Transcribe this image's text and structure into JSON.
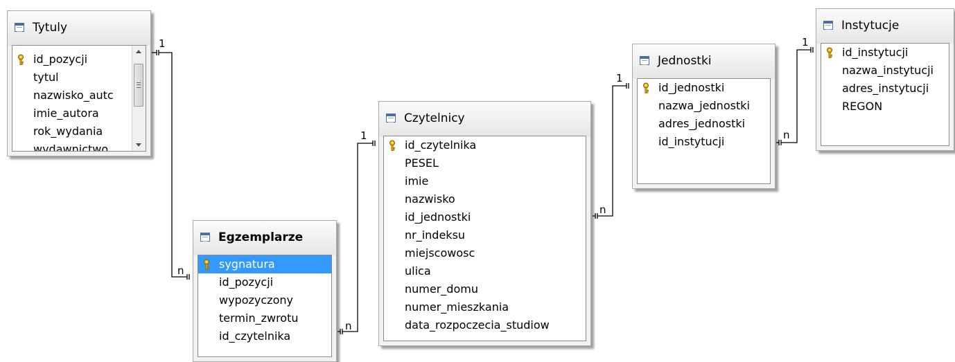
{
  "tables": [
    {
      "id": "tytuly",
      "title": "Tytuly",
      "columns": [
        {
          "name": "id_pozycji",
          "pk": true
        },
        {
          "name": "tytul"
        },
        {
          "name": "nazwisko_autc"
        },
        {
          "name": "imie_autora"
        },
        {
          "name": "rok_wydania"
        },
        {
          "name": "wydawnictwo"
        }
      ]
    },
    {
      "id": "egzemplarze",
      "title": "Egzemplarze",
      "columns": [
        {
          "name": "sygnatura",
          "pk": true
        },
        {
          "name": "id_pozycji"
        },
        {
          "name": "wypozyczony"
        },
        {
          "name": "termin_zwrotu"
        },
        {
          "name": "id_czytelnika"
        }
      ]
    },
    {
      "id": "czytelnicy",
      "title": "Czytelnicy",
      "columns": [
        {
          "name": "id_czytelnika",
          "pk": true
        },
        {
          "name": "PESEL"
        },
        {
          "name": "imie"
        },
        {
          "name": "nazwisko"
        },
        {
          "name": "id_jednostki"
        },
        {
          "name": "nr_indeksu"
        },
        {
          "name": "miejscowosc"
        },
        {
          "name": "ulica"
        },
        {
          "name": "numer_domu"
        },
        {
          "name": "numer_mieszkania"
        },
        {
          "name": "data_rozpoczecia_studiow"
        }
      ]
    },
    {
      "id": "jednostki",
      "title": "Jednostki",
      "columns": [
        {
          "name": "id_jednostki",
          "pk": true
        },
        {
          "name": "nazwa_jednostki"
        },
        {
          "name": "adres_jednostki"
        },
        {
          "name": "id_instytucji"
        }
      ]
    },
    {
      "id": "instytucje",
      "title": "Instytucje",
      "columns": [
        {
          "name": "id_instytucji",
          "pk": true
        },
        {
          "name": "nazwa_instytucji"
        },
        {
          "name": "adres_instytucji"
        },
        {
          "name": "REGON"
        }
      ]
    }
  ],
  "relations": [
    {
      "from": "tytuly",
      "to": "egzemplarze",
      "one_label": "1",
      "many_label": "n"
    },
    {
      "from": "czytelnicy",
      "to": "egzemplarze",
      "one_label": "1",
      "many_label": "n"
    },
    {
      "from": "jednostki",
      "to": "czytelnicy",
      "one_label": "1",
      "many_label": "n"
    },
    {
      "from": "instytucje",
      "to": "jednostki",
      "one_label": "1",
      "many_label": "n"
    }
  ],
  "selected": {
    "table": "egzemplarze",
    "column": "sygnatura"
  },
  "colors": {
    "selection": "#3399ff",
    "key_icon": "#f0b400",
    "title_icon": "#4a6ea6"
  },
  "icons": {
    "table": "table-icon",
    "primary_key": "key-icon",
    "scroll_up": "scroll-up-arrow-icon",
    "scroll_down": "scroll-down-arrow-icon"
  }
}
